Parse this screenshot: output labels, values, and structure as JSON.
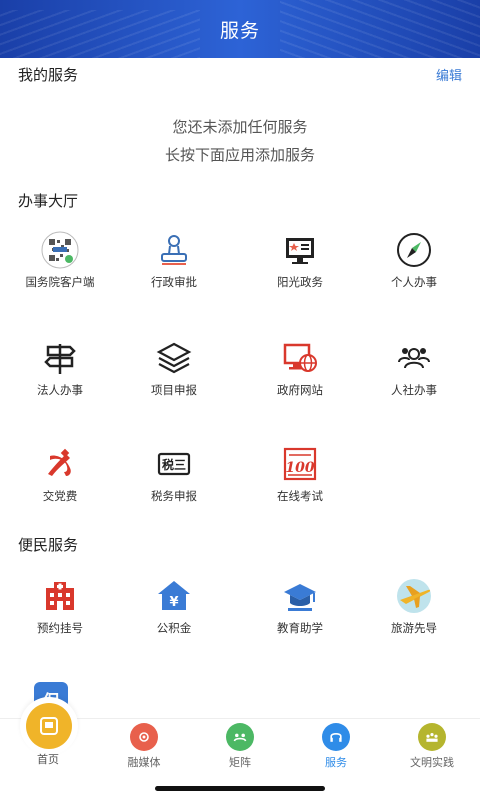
{
  "header": {
    "title": "服务"
  },
  "my_services": {
    "title": "我的服务",
    "edit": "编辑",
    "empty_line1": "您还未添加任何服务",
    "empty_line2": "长按下面应用添加服务"
  },
  "hall": {
    "title": "办事大厅",
    "items": [
      {
        "label": "国务院客户端",
        "icon": "qr-code-icon"
      },
      {
        "label": "行政审批",
        "icon": "stamp-icon"
      },
      {
        "label": "阳光政务",
        "icon": "monitor-icon"
      },
      {
        "label": "个人办事",
        "icon": "compass-icon"
      },
      {
        "label": "法人办事",
        "icon": "signpost-icon"
      },
      {
        "label": "项目申报",
        "icon": "layers-icon"
      },
      {
        "label": "政府网站",
        "icon": "web-monitor-icon"
      },
      {
        "label": "人社办事",
        "icon": "people-icon"
      },
      {
        "label": "交党费",
        "icon": "party-emblem-icon"
      },
      {
        "label": "税务申报",
        "icon": "tax-icon"
      },
      {
        "label": "在线考试",
        "icon": "exam-100-icon"
      }
    ]
  },
  "convenience": {
    "title": "便民服务",
    "items": [
      {
        "label": "预约挂号",
        "icon": "hospital-icon"
      },
      {
        "label": "公积金",
        "icon": "house-fund-icon"
      },
      {
        "label": "教育助学",
        "icon": "graduation-cap-icon"
      },
      {
        "label": "旅游先导",
        "icon": "airplane-icon"
      }
    ],
    "partial_icon_text": "保"
  },
  "bottom_nav": {
    "items": [
      {
        "label": "首页",
        "icon": "home-icon",
        "color": "#f0b429"
      },
      {
        "label": "融媒体",
        "icon": "media-icon",
        "color": "#e8604c"
      },
      {
        "label": "矩阵",
        "icon": "matrix-icon",
        "color": "#4cb864"
      },
      {
        "label": "服务",
        "icon": "service-icon",
        "color": "#2f8ce8",
        "active": true
      },
      {
        "label": "文明实践",
        "icon": "civilization-icon",
        "color": "#b5b52e"
      }
    ]
  },
  "colors": {
    "header": "#2457c9",
    "accent": "#3a7bd5",
    "active_tab": "#2f8ce8",
    "icon_red": "#d9382c"
  }
}
